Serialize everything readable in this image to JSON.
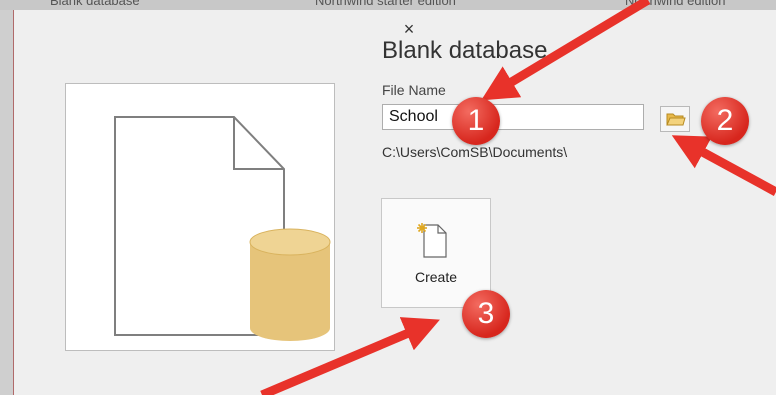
{
  "background_tabs": [
    "Blank database",
    "Northwind starter edition",
    "Northwind edition"
  ],
  "dialog": {
    "close_label": "×",
    "title": "Blank database",
    "file_name_label": "File Name",
    "file_name_value": "School",
    "path": "C:\\Users\\ComSB\\Documents\\",
    "create_label": "Create"
  },
  "annotations": [
    "1",
    "2",
    "3"
  ],
  "colors": {
    "arrow": "#e8322a",
    "badge": "#d7261d",
    "cylinder": "#e6c47a"
  },
  "icons": {
    "close": "close-icon",
    "browse": "folder-icon",
    "create": "new-document-icon",
    "preview": "blank-database-icon"
  }
}
